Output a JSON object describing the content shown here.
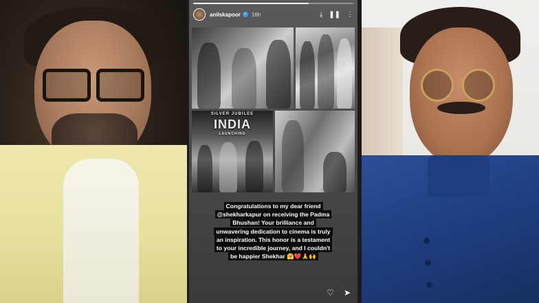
{
  "story": {
    "username": "anilskapoor",
    "verified_mark": "✓",
    "time_ago": "16h",
    "progress": 0.72,
    "icons": {
      "download": "download-icon",
      "pause": "pause-icon",
      "more": "more-icon",
      "like": "heart-icon",
      "share": "send-icon"
    },
    "collage": {
      "banner_top": "SILVER JUBILEE",
      "banner_main": "INDIA",
      "banner_sub": "LAUNCHING"
    },
    "caption_lines": [
      "Congratulations to my dear friend",
      "@shekharkapur on receiving the Padma",
      "Bhushan! Your brilliance and",
      "unwavering dedication to cinema is truly",
      "an inspiration. This honor is a testament",
      "to your incredible journey, and I couldn't",
      "be happier Shekhar 🤗❤️🙏🙌"
    ]
  },
  "colors": {
    "left_shirt": "#e6df9d",
    "right_jacket": "#1d3a7a",
    "story_bg": "#4a4a4a",
    "verified_blue": "#3897f0"
  }
}
